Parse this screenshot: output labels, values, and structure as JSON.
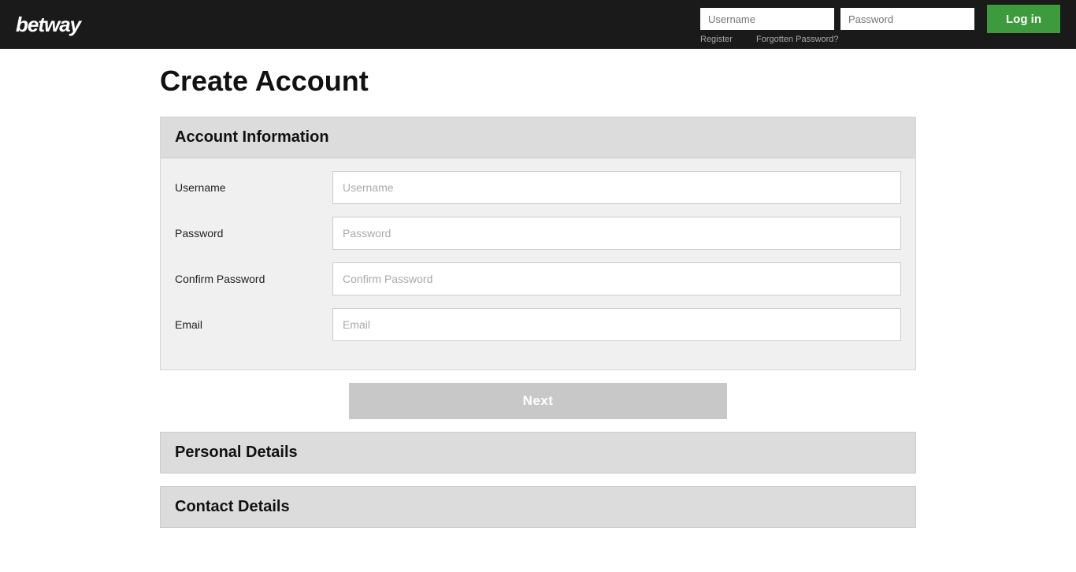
{
  "header": {
    "logo": "betway",
    "username_placeholder": "Username",
    "password_placeholder": "Password",
    "login_label": "Log in",
    "register_link": "Register",
    "forgotten_password_link": "Forgotten Password?"
  },
  "page": {
    "title": "Create Account"
  },
  "account_info_section": {
    "heading": "Account Information",
    "fields": [
      {
        "label": "Username",
        "placeholder": "Username",
        "type": "text",
        "name": "username"
      },
      {
        "label": "Password",
        "placeholder": "Password",
        "type": "password",
        "name": "password"
      },
      {
        "label": "Confirm Password",
        "placeholder": "Confirm Password",
        "type": "password",
        "name": "confirm_password"
      },
      {
        "label": "Email",
        "placeholder": "Email",
        "type": "email",
        "name": "email"
      }
    ],
    "next_button": "Next"
  },
  "personal_details_section": {
    "heading": "Personal Details"
  },
  "contact_details_section": {
    "heading": "Contact Details"
  }
}
